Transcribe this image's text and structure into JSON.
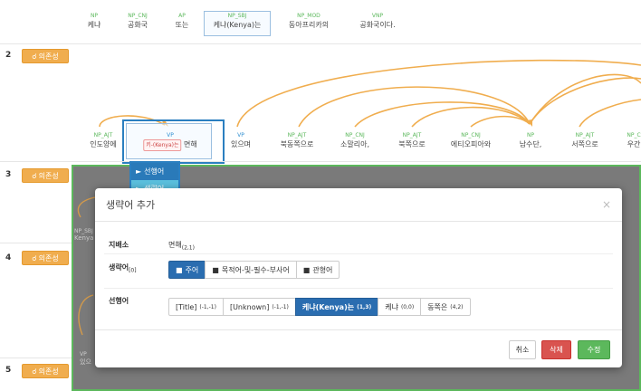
{
  "top_tokens": [
    {
      "tag": "NP",
      "word": "케냐"
    },
    {
      "tag": "NP_CNJ",
      "word": "공화국"
    },
    {
      "tag": "AP",
      "word": "또는"
    },
    {
      "tag": "NP_SBJ",
      "word": "케냐(Kenya)는"
    },
    {
      "tag": "NP_MOD",
      "word": "동아프리카의"
    },
    {
      "tag": "VNP",
      "word": "공화국이다."
    }
  ],
  "rows": [
    {
      "num": "2",
      "button": "의존성"
    },
    {
      "num": "3",
      "button": "의존성"
    },
    {
      "num": "4",
      "button": "의존성"
    },
    {
      "num": "5",
      "button": "의존성"
    }
  ],
  "row2_tokens": [
    {
      "tag": "NP_AJT",
      "word": "인도양에"
    },
    {
      "tag": "VP",
      "word": "면해",
      "pill": "키-(Kenya)는"
    },
    {
      "tag": "VP",
      "word": "있으며"
    },
    {
      "tag": "NP_AJT",
      "word": "북동쪽으로"
    },
    {
      "tag": "NP_CNJ",
      "word": "소말리아,"
    },
    {
      "tag": "NP_AJT",
      "word": "북쪽으로"
    },
    {
      "tag": "NP_CNJ",
      "word": "에티오피아와"
    },
    {
      "tag": "NP",
      "word": "남수단,"
    },
    {
      "tag": "NP_AJT",
      "word": "서쪽으로"
    },
    {
      "tag": "NP_C",
      "word": "우간"
    }
  ],
  "dropdown": {
    "item1": "선행어",
    "item2": "생략어"
  },
  "left_bg": {
    "tag": "NP_SBJ",
    "word": "Kenya",
    "tag2": "VP",
    "word2": "있으"
  },
  "modal": {
    "title": "생략어 추가",
    "close": "×",
    "governor_label": "지배소",
    "governor_value": "면해",
    "governor_sub": "(2,1)",
    "omitted_label": "생략어",
    "omitted_sub": "[0]",
    "omitted_options": [
      {
        "label": "주어",
        "active": true
      },
      {
        "label": "목적어-및-필수-부사어",
        "active": false
      },
      {
        "label": "관형어",
        "active": false
      }
    ],
    "antecedent_label": "선행어",
    "antecedent_options": [
      {
        "label": "[Title]",
        "sub": "(-1,-1)",
        "active": false
      },
      {
        "label": "[Unknown]",
        "sub": "(-1,-1)",
        "active": false
      },
      {
        "label": "케냐(Kenya)는",
        "sub": "(1,3)",
        "active": true
      },
      {
        "label": "케냐",
        "sub": "(0,0)",
        "active": false
      },
      {
        "label": "동쪽은",
        "sub": "(4,2)",
        "active": false
      }
    ],
    "cancel": "취소",
    "delete": "삭제",
    "edit": "수정"
  }
}
